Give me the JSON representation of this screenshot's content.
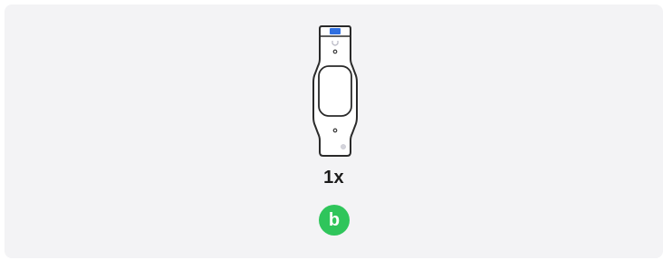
{
  "item": {
    "illustration_icon": "wall-mount-bracket-icon",
    "quantity": "1x",
    "label_letter": "b"
  },
  "colors": {
    "panel_background": "#f3f3f5",
    "badge_green": "#2fc55b",
    "outline": "#2a2a2a",
    "led_blue": "#2f6fe0"
  }
}
